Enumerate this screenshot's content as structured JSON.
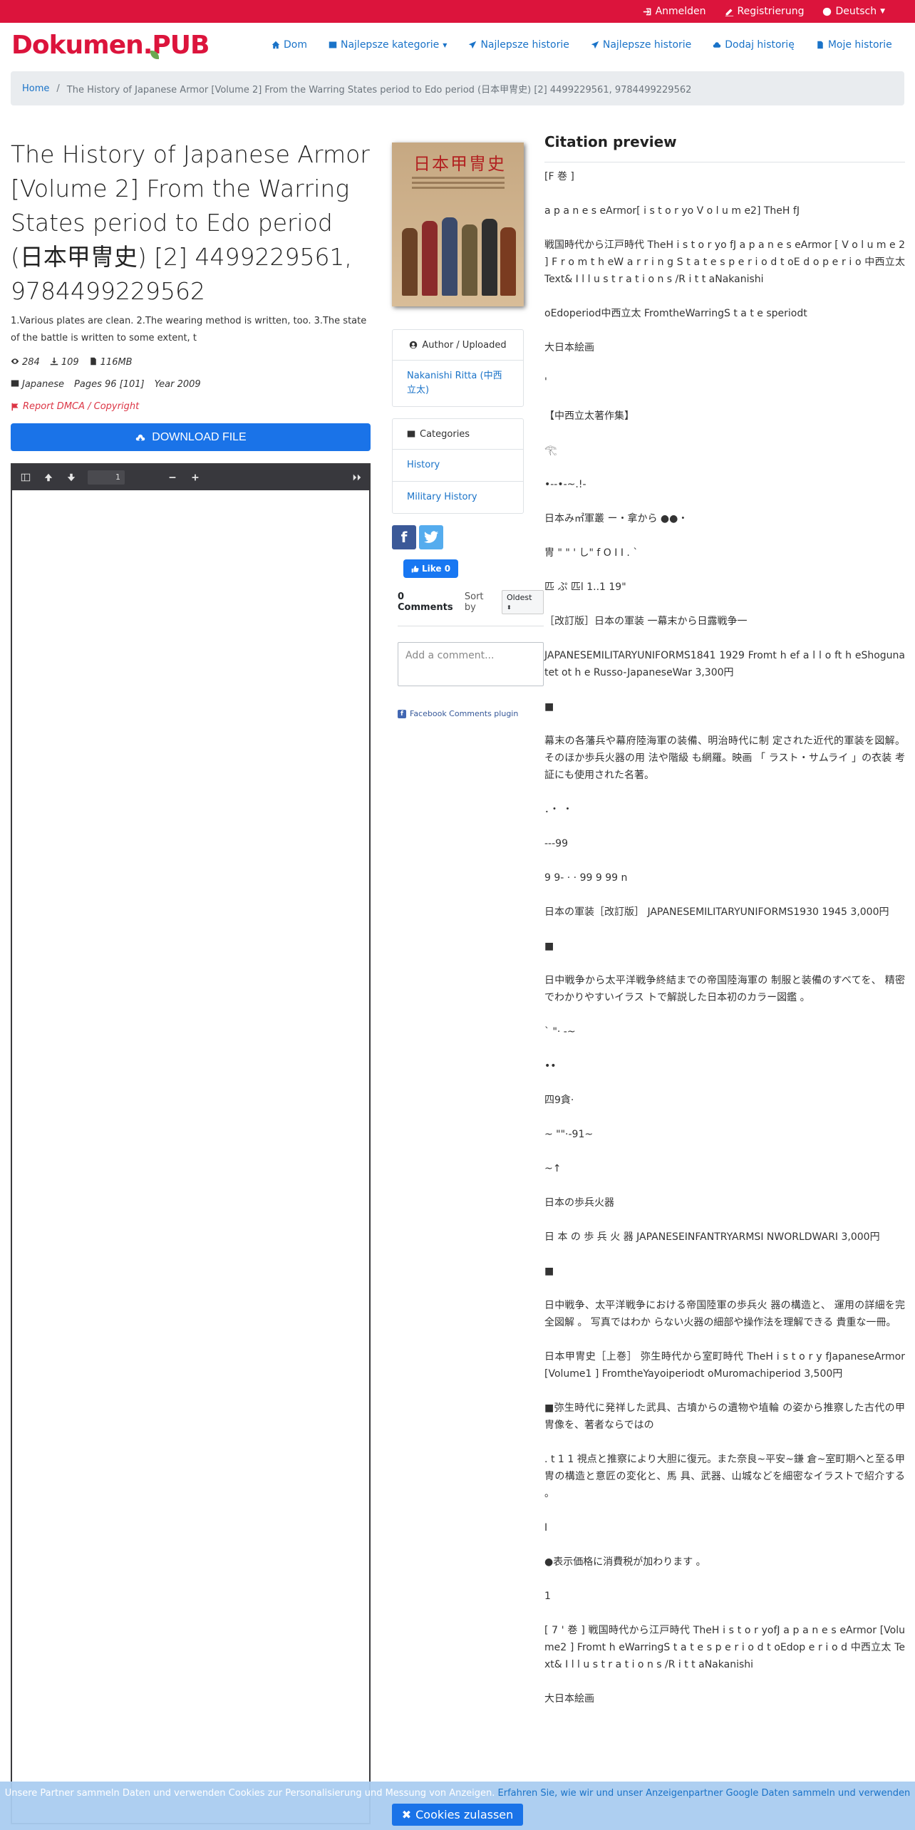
{
  "topbar": {
    "login": "Anmelden",
    "register": "Registrierung",
    "language": "Deutsch"
  },
  "brand": {
    "logo": "Dokumen.PUB"
  },
  "nav": {
    "home": "Dom",
    "categories": "Najlepsze kategorie",
    "top_stories1": "Najlepsze historie",
    "top_stories2": "Najlepsze historie",
    "add_story": "Dodaj historię",
    "my_stories": "Moje historie"
  },
  "breadcrumb": {
    "home": "Home",
    "current": "The History of Japanese Armor [Volume 2] From the Warring States period to Edo period (日本甲冑史) [2] 4499229561, 9784499229562"
  },
  "book": {
    "title": "The History of Japanese Armor [Volume 2] From the Warring States period to Edo period (日本甲冑史) [2] 4499229561, 9784499229562",
    "description": "1.Various plates are clean. 2.The wearing method is written, too. 3.The state of the battle is written to some extent, t",
    "views": "284",
    "downloads": "109",
    "size": "116MB",
    "language": "Japanese",
    "pages": "Pages 96 [101]",
    "year": "Year 2009",
    "report": "Report DMCA / Copyright",
    "download_label": "DOWNLOAD FILE",
    "cover_title": "日本甲冑史"
  },
  "viewer": {
    "page": "1"
  },
  "author_card": {
    "header": "Author / Uploaded",
    "author": "Nakanishi Ritta (中西立太)"
  },
  "categories_card": {
    "header": "Categories",
    "items": [
      "History",
      "Military History"
    ]
  },
  "social": {
    "like": "Like 0",
    "fb": "f"
  },
  "comments": {
    "count": "0 Comments",
    "sort_label": "Sort by",
    "sort_value": "Oldest",
    "placeholder": "Add a comment...",
    "plugin": "Facebook Comments plugin"
  },
  "citation": {
    "heading": "Citation preview",
    "paragraphs": [
      "[F 巻 ]",
      "a p a n e s eArmor[ i s t o r yo V o l u m e2] TheH fJ",
      "戦国時代から江戸時代 TheH i s t o r yo fJ a p a n e s eArmor [ V o l u m e 2 ] F r o m t h eW a r r i n g S t a t e s p e r i o d t oE d o p e r i o 中西立太 Text& I l l u s t r a t i o n s /R i t t aNakanishi",
      "oEdoperiod中西立太 FromtheWarringS t a t e speriodt",
      "大日本絵画",
      "'",
      "【中西立太著作集】",
      "𓂀",
      "•--•-~.!-",
      "日本み㎡軍叢 ー・拿から ●●・",
      "冑 \" \" ' し\" f O I I . `",
      "匹 ぷ 匹l 1..1 19\"",
      "［改訂版］日本の軍装 一幕末から日露戦争一",
      "JAPANESEMILITARYUNIFORMS1841 1929 Fromt h ef a l l o ft h eShogunatet ot h e Russo-JapaneseWar 3,300円",
      "■",
      "幕末の各藩兵や幕府陸海軍の装備、明治時代に制 定された近代的軍装を図解。そのほか歩兵火器の用 法や階級 も網羅。映画 「 ラスト・サムライ 」の衣装 考証にも使用された名著。",
      "．・ ・",
      "---99",
      "9 9- · · 99 9 99 n",
      "日本の軍装［改訂版］ JAPANESEMILITARYUNIFORMS1930 1945 3,000円",
      "■",
      "日中戦争から太平洋戦争終結までの帝国陸海軍の 制服と装備のすべてを、 精密でわかりやすいイラス トで解説した日本初のカラー図鑑 。",
      "` \"· -~",
      "••",
      "四9貪·",
      "~ \"\"·-91~",
      "~↑",
      "日本の歩兵火器",
      "日 本 の 歩 兵 火 器 JAPANESEINFANTRYARMSI NWORLDWARI 3,000円",
      "■",
      "日中戦争、太平洋戦争における帝国陸軍の歩兵火 器の構造と、 運用の詳細を完全図解 。 写真ではわか らない火器の細部や操作法を理解できる 貴重な一冊。",
      "日本甲冑史［上巻］ 弥生時代から室町時代 TheH i s t o r y fJapaneseArmor[Volume1 ] FromtheYayoiperiodt oMuromachiperiod 3,500円",
      "■弥生時代に発祥した武具、古墳からの遺物や埴輪 の姿から推察した古代の甲冑像を、著者ならではの",
      ". t 1 1 視点と推察により大胆に復元。また奈良~平安~鎌 倉~室町期へと至る甲冑の構造と意匠の変化と、馬 具、武器、山城などを細密なイラストで紹介する 。",
      "I",
      "●表示価格に消費税が加わります 。",
      "1",
      "[ 7 ' 巻 ] 戦国時代から江戸時代 TheH i s t o r yofJ a p a n e s eArmor [Volume2 ] Fromt h eWarringS t a t e s p e r i o d t oEdop e r i o d 中西立太 Text& I l l u s t r a t i o n s /R i t t aNakanishi",
      "大日本絵画"
    ]
  },
  "cookie": {
    "text": "Unsere Partner sammeln Daten und verwenden Cookies zur Personalisierung und Messung von Anzeigen.",
    "link": "Erfahren Sie, wie wir und unser Anzeigenpartner Google Daten sammeln und verwenden",
    "button": "Cookies zulassen"
  }
}
